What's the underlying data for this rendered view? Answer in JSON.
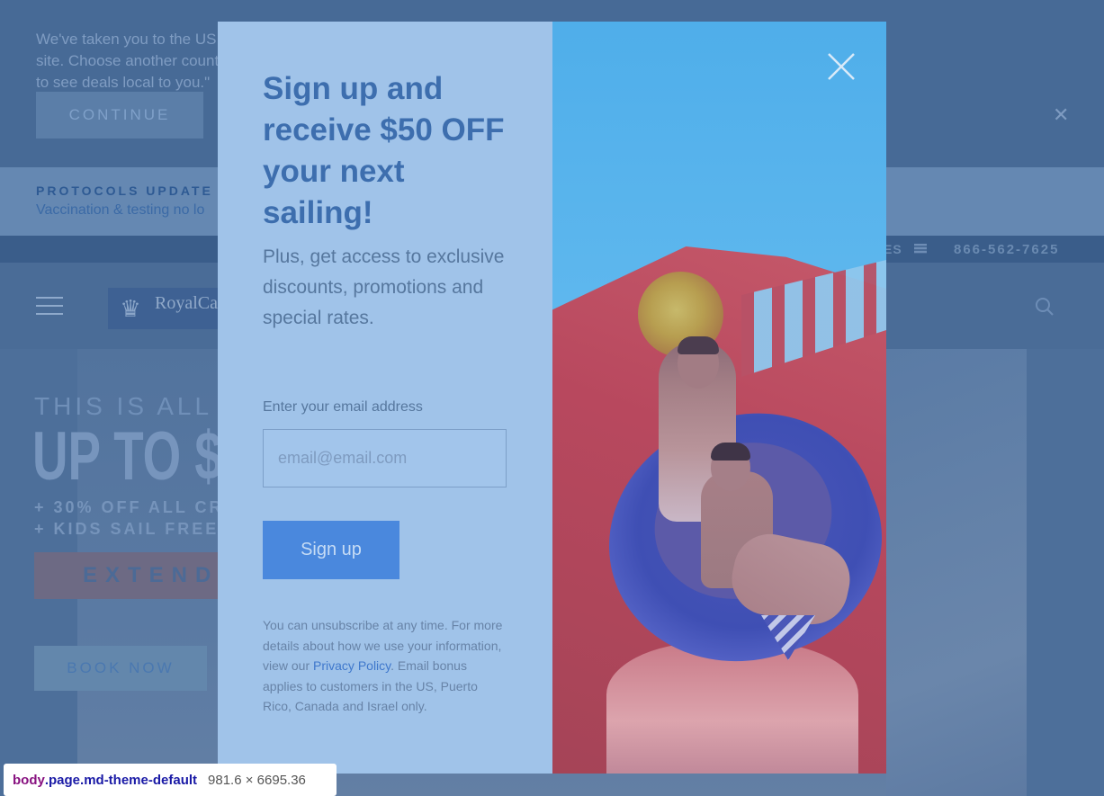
{
  "background": {
    "country_banner": {
      "text": "We've taken you to the US site. Choose another country to see deals local to you.\"",
      "continue_label": "CONTINUE",
      "close_glyph": "✕"
    },
    "protocols": {
      "title": "PROTOCOLS UPDATE",
      "link": "Vaccination & testing no lo"
    },
    "utility": {
      "item": "ES",
      "phone": "866-562-7625"
    },
    "nav": {
      "logo_text": "RoyalCa"
    },
    "hero": {
      "line1": "THIS IS ALL T",
      "line2": "UP TO $",
      "line3": "+ 30% OFF ALL CR",
      "line4": "+ KIDS SAIL FREE*",
      "extended_label": "EXTENDE",
      "book_label": "BOOK NOW"
    }
  },
  "modal": {
    "heading": "Sign up and receive $50 OFF your next sailing!",
    "subheading": "Plus, get access to exclusive discounts, promotions and special rates.",
    "email_label": "Enter your email address",
    "email_placeholder": "email@email.com",
    "email_value": "",
    "signup_label": "Sign up",
    "disclaimer_before": "You can unsubscribe at any time. For more details about how we use your information, view our ",
    "privacy_link": "Privacy Policy",
    "disclaimer_after": ". Email bonus applies to customers in the US, Puerto Rico, Canada and Israel only."
  },
  "devtools_tooltip": {
    "tag": "body",
    "classes": ".page.md-theme-default",
    "size": "981.6 × 6695.36"
  },
  "colors": {
    "overlay": "#4a6c97",
    "modal_panel": "#a0c3e9",
    "heading": "#3d6eae",
    "button": "#4a88dd",
    "link": "#3f78cc"
  }
}
